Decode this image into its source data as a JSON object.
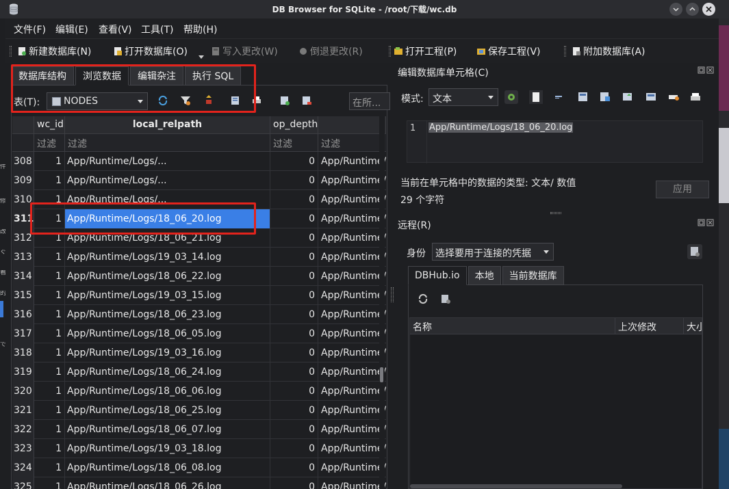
{
  "window": {
    "title": "DB Browser for SQLite - /root/下载/wc.db"
  },
  "menu": [
    "文件(F)",
    "编辑(E)",
    "查看(V)",
    "工具(T)",
    "帮助(H)"
  ],
  "toolbar": {
    "new_db": "新建数据库(N)",
    "open_db": "打开数据库(O)",
    "write_changes": "写入更改(W)",
    "revert_changes": "倒退更改(R)",
    "open_project": "打开工程(P)",
    "save_project": "保存工程(V)",
    "attach_db": "附加数据库(A)"
  },
  "tabs": [
    "数据库结构",
    "浏览数据",
    "编辑杂注",
    "执行 SQL"
  ],
  "active_tab": "浏览数据",
  "table_selector": {
    "label": "表(T):",
    "value": "NODES",
    "filter_placeholder": "在所..."
  },
  "grid": {
    "columns": [
      "wc_id",
      "local_relpath",
      "op_depth",
      ""
    ],
    "filter_placeholder": "过滤",
    "selected_row": "311",
    "rows": [
      {
        "n": "308",
        "wc_id": "1",
        "path": "App/Runtime/Logs/...",
        "op": "0",
        "next": "App/Runtime/"
      },
      {
        "n": "309",
        "wc_id": "1",
        "path": "App/Runtime/Logs/...",
        "op": "0",
        "next": "App/Runtime/"
      },
      {
        "n": "310",
        "wc_id": "1",
        "path": "App/Runtime/Logs/...",
        "op": "0",
        "next": "App/Runtime/"
      },
      {
        "n": "311",
        "wc_id": "1",
        "path": "App/Runtime/Logs/18_06_20.log",
        "op": "0",
        "next": "App/Runtime/"
      },
      {
        "n": "312",
        "wc_id": "1",
        "path": "App/Runtime/Logs/18_06_21.log",
        "op": "0",
        "next": "App/Runtime/"
      },
      {
        "n": "313",
        "wc_id": "1",
        "path": "App/Runtime/Logs/19_03_14.log",
        "op": "0",
        "next": "App/Runtime/"
      },
      {
        "n": "314",
        "wc_id": "1",
        "path": "App/Runtime/Logs/18_06_22.log",
        "op": "0",
        "next": "App/Runtime/"
      },
      {
        "n": "315",
        "wc_id": "1",
        "path": "App/Runtime/Logs/19_03_15.log",
        "op": "0",
        "next": "App/Runtime/"
      },
      {
        "n": "316",
        "wc_id": "1",
        "path": "App/Runtime/Logs/18_06_23.log",
        "op": "0",
        "next": "App/Runtime/"
      },
      {
        "n": "317",
        "wc_id": "1",
        "path": "App/Runtime/Logs/18_06_05.log",
        "op": "0",
        "next": "App/Runtime/"
      },
      {
        "n": "318",
        "wc_id": "1",
        "path": "App/Runtime/Logs/19_03_16.log",
        "op": "0",
        "next": "App/Runtime/"
      },
      {
        "n": "319",
        "wc_id": "1",
        "path": "App/Runtime/Logs/18_06_24.log",
        "op": "0",
        "next": "App/Runtime/"
      },
      {
        "n": "320",
        "wc_id": "1",
        "path": "App/Runtime/Logs/18_06_06.log",
        "op": "0",
        "next": "App/Runtime/"
      },
      {
        "n": "321",
        "wc_id": "1",
        "path": "App/Runtime/Logs/18_06_25.log",
        "op": "0",
        "next": "App/Runtime/"
      },
      {
        "n": "322",
        "wc_id": "1",
        "path": "App/Runtime/Logs/18_06_07.log",
        "op": "0",
        "next": "App/Runtime/"
      },
      {
        "n": "323",
        "wc_id": "1",
        "path": "App/Runtime/Logs/19_03_18.log",
        "op": "0",
        "next": "App/Runtime/"
      },
      {
        "n": "324",
        "wc_id": "1",
        "path": "App/Runtime/Logs/18_06_08.log",
        "op": "0",
        "next": "App/Runtime/"
      },
      {
        "n": "325",
        "wc_id": "1",
        "path": "App/Runtime/Logs/18_06_26.log",
        "op": "0",
        "next": "App/Runtime/"
      }
    ]
  },
  "edit_cell": {
    "title": "编辑数据库单元格(C)",
    "mode_label": "模式:",
    "mode_value": "文本",
    "line_number": "1",
    "content": "App/Runtime/Logs/18_06_20.log",
    "type_info": "当前在单元格中的数据的类型: 文本/ 数值",
    "char_count": "29 个字符",
    "apply": "应用"
  },
  "remote": {
    "title": "远程(R)",
    "identity_label": "身份",
    "identity_value": "选择要用于连接的凭据",
    "tabs": [
      "DBHub.io",
      "本地",
      "当前数据库"
    ],
    "columns": [
      "名称",
      "上次修改",
      "大小"
    ]
  },
  "colors": {
    "selection": "#3a7fe6",
    "annotation": "#e3231c",
    "background": "#1e1f22"
  }
}
